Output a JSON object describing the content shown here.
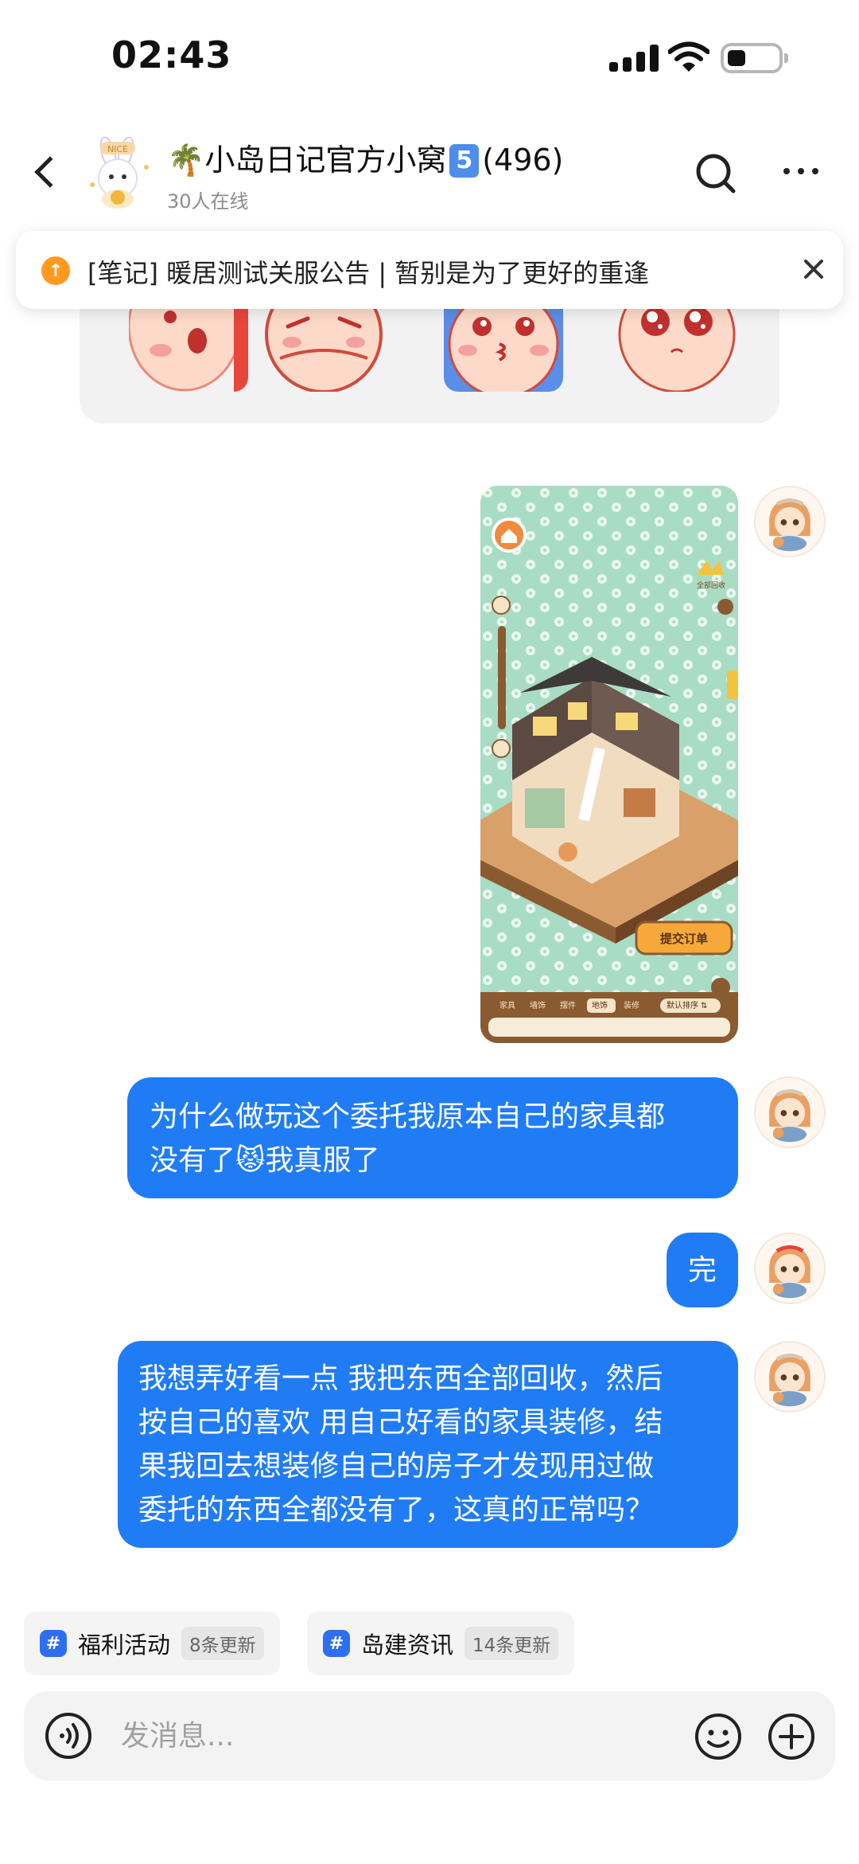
{
  "status_bar": {
    "time": "02:43",
    "icons": [
      "signal-icon",
      "wifi-icon",
      "battery-icon"
    ]
  },
  "header": {
    "group_title": "🌴小岛日记官方小窝",
    "badge": "5",
    "member_count": "(496)",
    "online_status": "30人在线",
    "avatar_text": "NICE"
  },
  "notice": {
    "icon_glyph": "↑",
    "text": "[笔记] 暖居测试关服公告 | 暂别是为了更好的重逢"
  },
  "shared_image": {
    "button_text": "提交订单",
    "crown_caption": "全部回收",
    "tabs": [
      "家具",
      "墙饰",
      "摆件",
      "地饰",
      "装修",
      "默认排序 ⇅"
    ],
    "active_tab_index": 3
  },
  "messages": [
    {
      "text_line1": "为什么做玩这个委托我原本自己的家具都",
      "text_line2": "没有了😾我真服了"
    },
    {
      "text": "完"
    },
    {
      "lines": [
        "我想弄好看一点 我把东西全部回收，然后",
        "按自己的喜欢 用自己好看的家具装修，结",
        "果我回去想装修自己的房子才发现用过做",
        "委托的东西全都没有了，这真的正常吗？"
      ]
    }
  ],
  "channels": [
    {
      "icon": "#",
      "label": "福利活动",
      "count": "8条更新"
    },
    {
      "icon": "#",
      "label": "岛建资讯",
      "count": "14条更新"
    }
  ],
  "input": {
    "placeholder": "发消息..."
  },
  "colors": {
    "bubble": "#1f7cf5",
    "accent": "#2d6ff0",
    "notice_icon": "#ff9a1f"
  }
}
